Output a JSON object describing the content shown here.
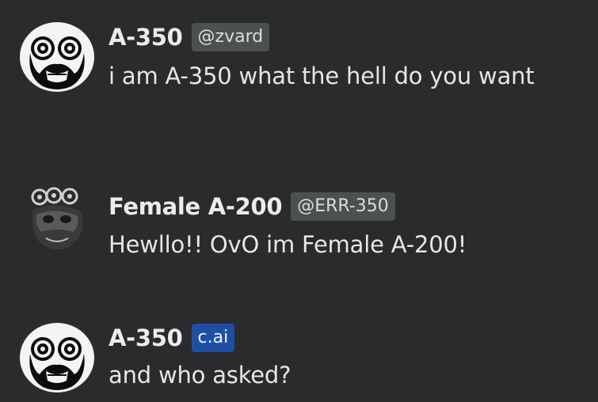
{
  "messages": [
    {
      "author": "A-350",
      "badge": "@zvard",
      "text": "i am A-350 what the hell do you want",
      "avatar_icon": "a350-face-avatar"
    },
    {
      "author": "Female A-200",
      "badge": "@ERR-350",
      "text": "Hewllo!! OvO im Female A-200!",
      "avatar_icon": "female-a200-avatar"
    },
    {
      "author": "A-350",
      "badge": "c.ai",
      "text": "and who asked?",
      "avatar_icon": "a350-face-avatar"
    }
  ],
  "colors": {
    "background": "#2a2b2c",
    "user_badge": "#4d5051",
    "cai_badge": "#1f4fa3"
  }
}
